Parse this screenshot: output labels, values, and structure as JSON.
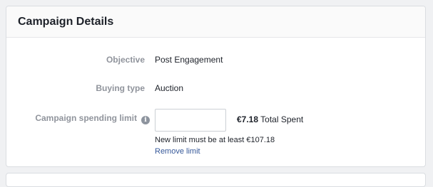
{
  "card": {
    "title": "Campaign Details"
  },
  "fields": {
    "objective": {
      "label": "Objective",
      "value": "Post Engagement"
    },
    "buying_type": {
      "label": "Buying type",
      "value": "Auction"
    },
    "spending_limit": {
      "label": "Campaign spending limit",
      "info_icon": "info-icon",
      "input_value": "",
      "input_placeholder": "",
      "spent_amount": "€7.18",
      "spent_suffix": "Total Spent",
      "note": "New limit must be at least €107.18",
      "remove_link": "Remove limit"
    }
  },
  "colors": {
    "link": "#365899",
    "label": "#90949c",
    "text": "#1d2129"
  }
}
